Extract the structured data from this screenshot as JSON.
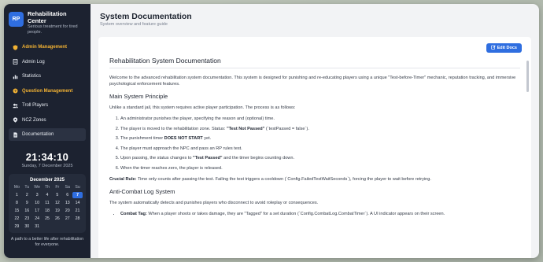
{
  "app": {
    "logo_text": "RP",
    "title": "Rehabilitation Center",
    "subtitle": "Serious treatment for tired people."
  },
  "nav": [
    {
      "label": "Admin Management",
      "icon": "shield-icon",
      "style": "gold"
    },
    {
      "label": "Admin Log",
      "icon": "log-icon",
      "style": "normal"
    },
    {
      "label": "Statistics",
      "icon": "chart-icon",
      "style": "normal"
    },
    {
      "label": "Question Management",
      "icon": "question-icon",
      "style": "gold"
    },
    {
      "label": "Troll Players",
      "icon": "users-icon",
      "style": "normal"
    },
    {
      "label": "NCZ Zones",
      "icon": "zone-icon",
      "style": "normal"
    },
    {
      "label": "Documentation",
      "icon": "doc-icon",
      "style": "active"
    }
  ],
  "clock": {
    "time": "21:34:10",
    "date": "Sunday, 7 December 2025"
  },
  "calendar": {
    "title": "December 2025",
    "weekdays": [
      "Mo",
      "Tu",
      "We",
      "Th",
      "Fr",
      "Sa",
      "Su"
    ],
    "days": [
      "1",
      "2",
      "3",
      "4",
      "5",
      "6",
      "7",
      "8",
      "9",
      "10",
      "11",
      "12",
      "13",
      "14",
      "15",
      "16",
      "17",
      "18",
      "19",
      "20",
      "21",
      "22",
      "23",
      "24",
      "25",
      "26",
      "27",
      "28",
      "29",
      "30",
      "31"
    ],
    "today": "7"
  },
  "footer": "A path to a better life after rehabilitation for everyone.",
  "header": {
    "title": "System Documentation",
    "subtitle": "System overview and feature guide"
  },
  "edit_button": "Edit Docs",
  "doc": {
    "title": "Rehabilitation System Documentation",
    "intro": "Welcome to the advanced rehabilitation system documentation. This system is designed for punishing and re-educating players using a unique \"Test-before-Timer\" mechanic, reputation tracking, and immersive psychological enforcement features.",
    "section1_title": "Main System Principle",
    "section1_intro": "Unlike a standard jail, this system requires active player participation. The process is as follows:",
    "steps": [
      {
        "pre": "An administrator punishes the player, specifying the reason and (optional) time.",
        "bold": "",
        "post": ""
      },
      {
        "pre": "The player is moved to the rehabilitation zone. Status: ",
        "bold": "\"Test Not Passed\"",
        "post": " (`testPassed = false`)."
      },
      {
        "pre": "The punishment timer ",
        "bold": "DOES NOT START",
        "post": " yet."
      },
      {
        "pre": "The player must approach the NPC and pass an RP rules test.",
        "bold": "",
        "post": ""
      },
      {
        "pre": "Upon passing, the status changes to ",
        "bold": "\"Test Passed\"",
        "post": " and the timer begins counting down."
      },
      {
        "pre": "When the timer reaches zero, the player is released.",
        "bold": "",
        "post": ""
      }
    ],
    "crucial_label": "Crucial Rule:",
    "crucial_text": " Time only counts after passing the test. Failing the test triggers a cooldown (`Config.FailedTestWaitSeconds`), forcing the player to wait before retrying.",
    "section2_title": "Anti-Combat Log System",
    "section2_intro": "The system automatically detects and punishes players who disconnect to avoid roleplay or consequences.",
    "combat_label": "Combat Tag:",
    "combat_text": " When a player shoots or takes damage, they are \"Tagged\" for a set duration (`Config.CombatLog.CombatTimer`). A UI indicator appears on their screen."
  },
  "colors": {
    "accent": "#2f6ee0",
    "sidebar_bg": "#1c2230",
    "gold": "#f2b233"
  }
}
